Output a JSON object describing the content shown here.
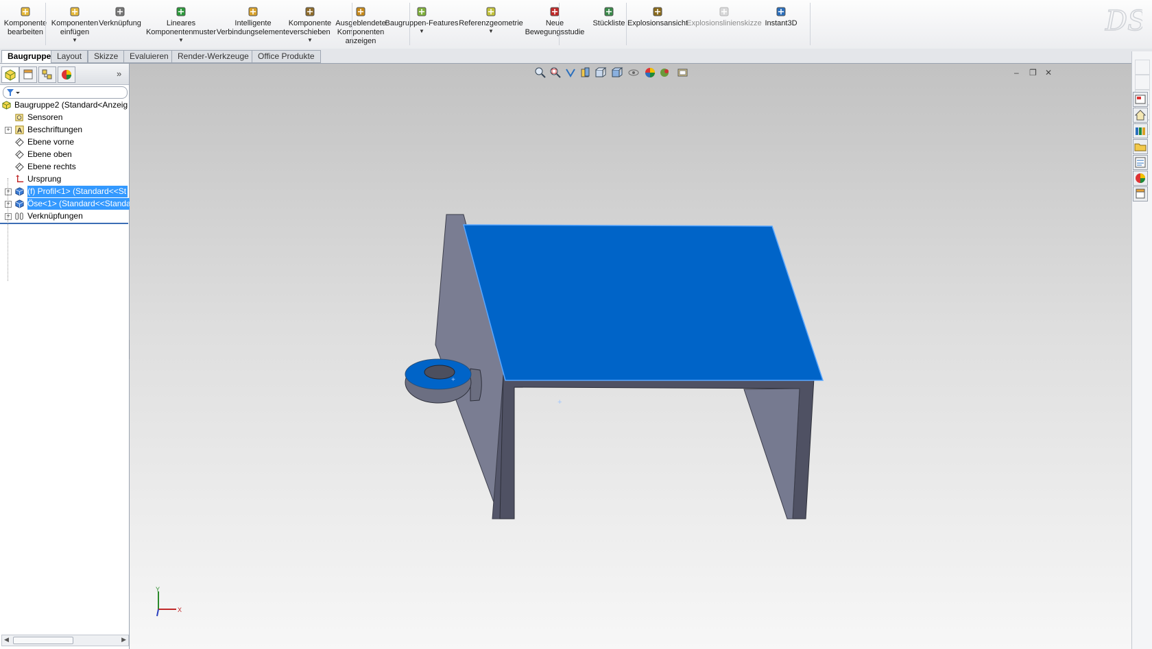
{
  "ribbon": {
    "buttons": [
      {
        "label": "Komponente\nbearbeiten",
        "icon": "edit-component-icon",
        "dropdown": false
      },
      {
        "label": "Komponenten\neinfügen",
        "icon": "insert-components-icon",
        "dropdown": true
      },
      {
        "label": "Verknüpfung",
        "icon": "mate-icon",
        "dropdown": false
      },
      {
        "label": "Lineares\nKomponentenmuster",
        "icon": "linear-pattern-icon",
        "dropdown": true
      },
      {
        "label": "Intelligente\nVerbindungselemente",
        "icon": "smart-fasteners-icon",
        "dropdown": false
      },
      {
        "label": "Komponente\nverschieben",
        "icon": "move-component-icon",
        "dropdown": true
      },
      {
        "label": "Ausgeblendete\nKomponenten\nanzeigen",
        "icon": "show-hidden-components-icon",
        "dropdown": false
      },
      {
        "label": "Baugruppen-Features",
        "icon": "assembly-features-icon",
        "dropdown": true
      },
      {
        "label": "Referenzgeometrie",
        "icon": "reference-geometry-icon",
        "dropdown": true
      },
      {
        "label": "Neue\nBewegungsstudie",
        "icon": "new-motion-study-icon",
        "dropdown": false
      },
      {
        "label": "Stückliste",
        "icon": "bill-of-materials-icon",
        "dropdown": false
      },
      {
        "label": "Explosionsansicht",
        "icon": "exploded-view-icon",
        "dropdown": false
      },
      {
        "label": "Explosionslinienskizze",
        "icon": "explode-line-sketch-icon",
        "dropdown": false,
        "disabled": true
      },
      {
        "label": "Instant3D",
        "icon": "instant3d-icon",
        "dropdown": false
      }
    ]
  },
  "tabs": [
    "Baugruppe",
    "Layout",
    "Skizze",
    "Evaluieren",
    "Render-Werkzeuge",
    "Office Produkte"
  ],
  "active_tab": "Baugruppe",
  "tree": {
    "root": "Baugruppe2  (Standard<Anzeig",
    "items": [
      {
        "label": "Sensoren",
        "icon": "sensors-icon",
        "expandable": false
      },
      {
        "label": "Beschriftungen",
        "icon": "annotations-icon",
        "expandable": true
      },
      {
        "label": "Ebene vorne",
        "icon": "plane-icon",
        "expandable": false
      },
      {
        "label": "Ebene oben",
        "icon": "plane-icon",
        "expandable": false
      },
      {
        "label": "Ebene rechts",
        "icon": "plane-icon",
        "expandable": false
      },
      {
        "label": "Ursprung",
        "icon": "origin-icon",
        "expandable": false
      },
      {
        "label": "(f) Profil<1> (Standard<<St",
        "icon": "part-icon",
        "expandable": true,
        "selected": true
      },
      {
        "label": "Öse<1> (Standard<<Standa",
        "icon": "part-icon",
        "expandable": true,
        "selected": true
      },
      {
        "label": "Verknüpfungen",
        "icon": "mates-icon",
        "expandable": true
      }
    ]
  },
  "triad": {
    "x": "X",
    "y": "Y"
  },
  "colors": {
    "selection": "#0064c8",
    "part_side": "#7b7e93",
    "tree_selection": "#3399ff"
  }
}
